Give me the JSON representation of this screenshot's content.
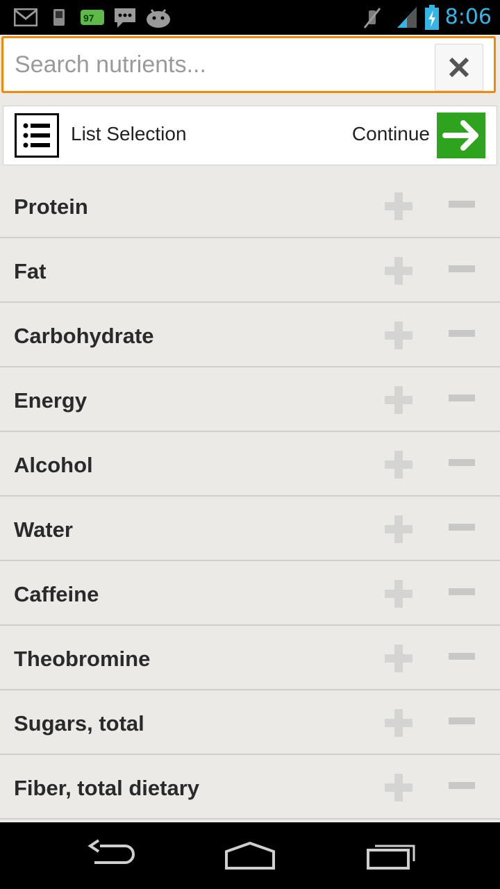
{
  "status_bar": {
    "time": "8:06",
    "battery_badge": "97",
    "icons": [
      "gmail-icon",
      "phone-icon",
      "battery-widget-icon",
      "chat-icon",
      "android-icon",
      "mute-icon",
      "signal-icon",
      "battery-icon"
    ]
  },
  "search": {
    "placeholder": "Search nutrients...",
    "value": ""
  },
  "toolbar": {
    "list_selection_label": "List Selection",
    "continue_label": "Continue"
  },
  "nutrients": [
    {
      "label": "Protein"
    },
    {
      "label": "Fat"
    },
    {
      "label": "Carbohydrate"
    },
    {
      "label": "Energy"
    },
    {
      "label": "Alcohol"
    },
    {
      "label": "Water"
    },
    {
      "label": "Caffeine"
    },
    {
      "label": "Theobromine"
    },
    {
      "label": "Sugars, total"
    },
    {
      "label": "Fiber, total dietary"
    }
  ],
  "colors": {
    "accent": "#f0890a",
    "continue_green": "#2ea31d",
    "status_blue": "#33b5e5"
  }
}
